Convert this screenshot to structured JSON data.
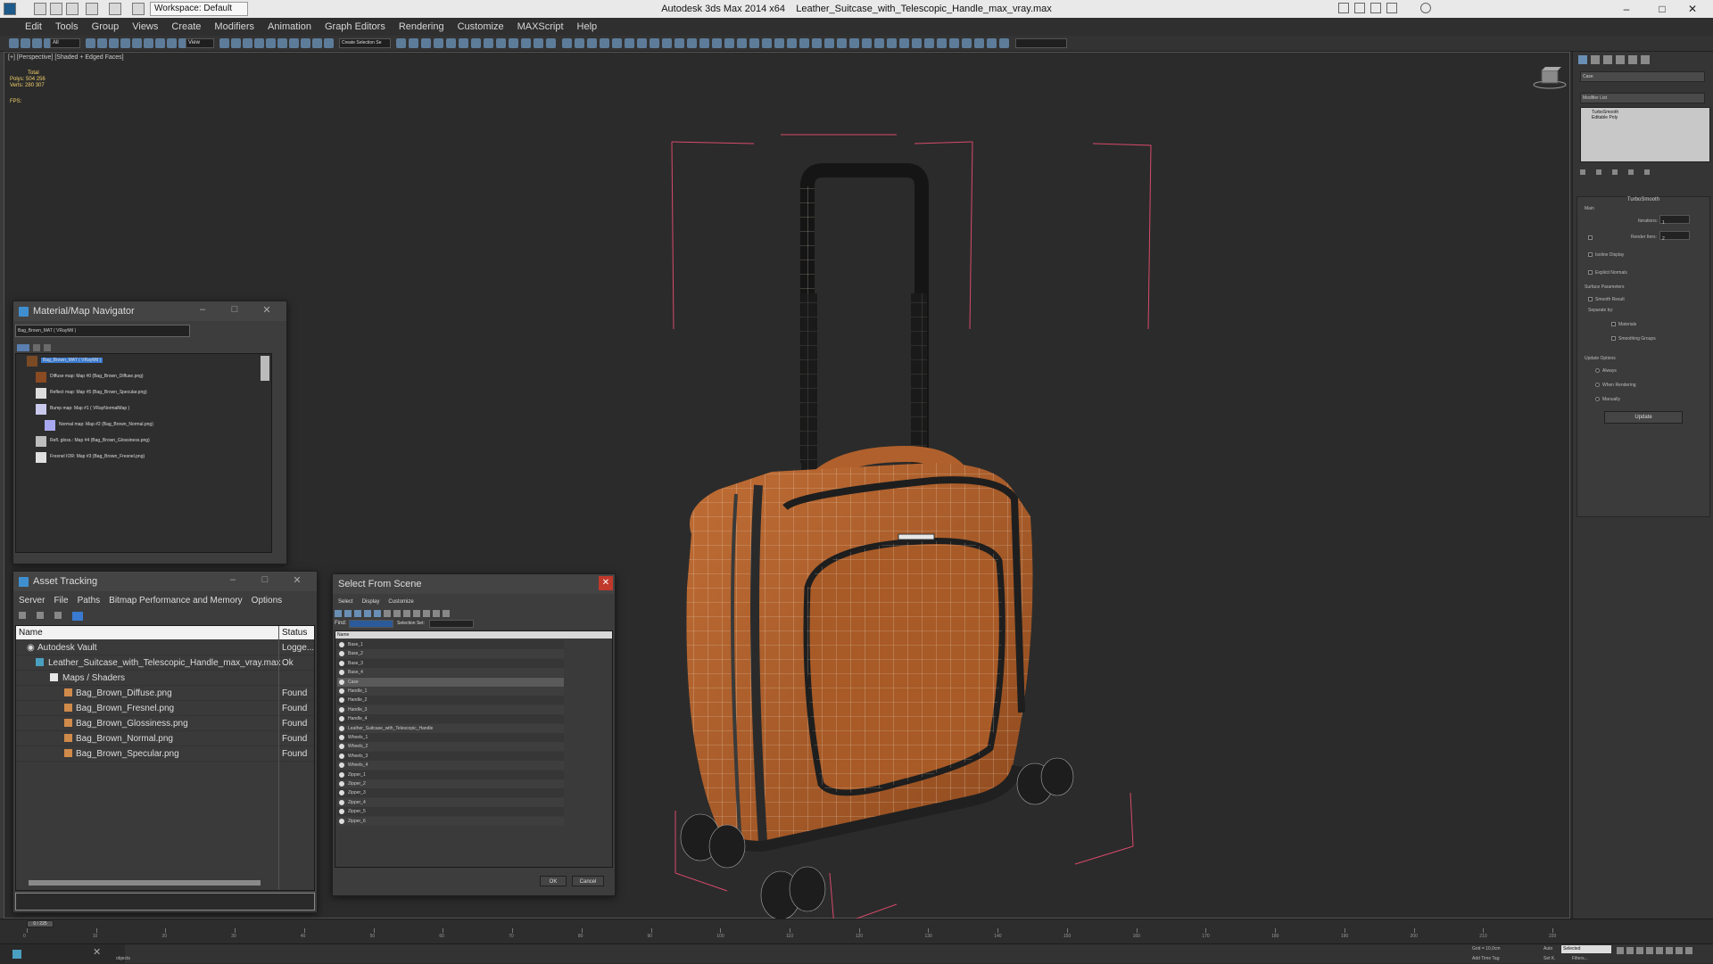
{
  "window": {
    "app_title": "Autodesk 3ds Max  2014 x64",
    "file_title": "Leather_Suitcase_with_Telescopic_Handle_max_vray.max",
    "workspace": "Workspace: Default"
  },
  "menu": [
    "Edit",
    "Tools",
    "Group",
    "Views",
    "Create",
    "Modifiers",
    "Animation",
    "Graph Editors",
    "Rendering",
    "Customize",
    "MAXScript",
    "Help"
  ],
  "toolbar": {
    "selection_filter": "All",
    "ref_coord": "View",
    "named_selection": "Create Selection Se"
  },
  "viewport": {
    "label": "[+] [Perspective] [Shaded + Edged Faces]",
    "stats_title": "Total",
    "polys_label": "Polys:",
    "polys_value": "504 256",
    "verts_label": "Verts:",
    "verts_value": "280 307",
    "fps_label": "FPS:"
  },
  "command_panel": {
    "object_name": "Case",
    "modifier_list": "Modifier List",
    "stack": [
      "TurboSmooth",
      "Editable Poly"
    ],
    "rollout_title": "TurboSmooth",
    "main_label": "Main",
    "iterations_label": "Iterations:",
    "iterations_value": "1",
    "render_iters_label": "Render Iters:",
    "render_iters_value": "2",
    "isoline_label": "Isoline Display",
    "explicit_normals_label": "Explicit Normals",
    "surface_params_label": "Surface Parameters",
    "smooth_result_label": "Smooth Result",
    "separate_by_label": "Separate by:",
    "materials_label": "Materials",
    "smoothing_groups_label": "Smoothing Groups",
    "update_options_label": "Update Options",
    "always_label": "Always",
    "when_rendering_label": "When Rendering",
    "manually_label": "Manually",
    "update_button": "Update"
  },
  "material_navigator": {
    "title": "Material/Map Navigator",
    "current": "Bag_Brown_MAT  ( VRayMtl )",
    "root": "Bag_Brown_MAT  ( VRayMtl )",
    "maps": [
      "Diffuse map: Map #0 (Bag_Brown_Diffuse.png)",
      "Reflect map: Map #5 (Bag_Brown_Specular.png)",
      "Bump map: Map #1  ( VRayNormalMap )",
      "Normal map: Map #2 (Bag_Brown_Normal.png)",
      "Refl. gloss.: Map #4 (Bag_Brown_Glossiness.png)",
      "Fresnel IOR: Map #3 (Bag_Brown_Fresnel.png)"
    ]
  },
  "asset_tracking": {
    "title": "Asset Tracking",
    "menu": [
      "Server",
      "File",
      "Paths",
      "Bitmap Performance and Memory",
      "Options"
    ],
    "columns": [
      "Name",
      "Status"
    ],
    "rows": [
      {
        "name": "Autodesk Vault",
        "status": "Logge..."
      },
      {
        "name": "Leather_Suitcase_with_Telescopic_Handle_max_vray.max",
        "status": "Ok"
      },
      {
        "name": "Maps / Shaders",
        "status": ""
      },
      {
        "name": "Bag_Brown_Diffuse.png",
        "status": "Found"
      },
      {
        "name": "Bag_Brown_Fresnel.png",
        "status": "Found"
      },
      {
        "name": "Bag_Brown_Glossiness.png",
        "status": "Found"
      },
      {
        "name": "Bag_Brown_Normal.png",
        "status": "Found"
      },
      {
        "name": "Bag_Brown_Specular.png",
        "status": "Found"
      }
    ]
  },
  "select_from_scene": {
    "title": "Select From Scene",
    "menu": [
      "Select",
      "Display",
      "Customize"
    ],
    "find_label": "Find:",
    "selection_set_label": "Selection Set:",
    "column_name": "Name",
    "items": [
      "Base_1",
      "Base_2",
      "Base_3",
      "Base_4",
      "Case",
      "Handle_1",
      "Handle_2",
      "Handle_3",
      "Handle_4",
      "Leather_Suitcase_with_Telescopic_Handle",
      "Wheels_1",
      "Wheels_2",
      "Wheels_3",
      "Wheels_4",
      "Zipper_1",
      "Zipper_2",
      "Zipper_3",
      "Zipper_4",
      "Zipper_5",
      "Zipper_6"
    ],
    "selected_item": "Case",
    "ok_label": "OK",
    "cancel_label": "Cancel"
  },
  "timeline": {
    "frame_counter": "0 / 225",
    "ticks": [
      "0",
      "10",
      "20",
      "30",
      "40",
      "50",
      "60",
      "70",
      "80",
      "90",
      "100",
      "110",
      "120",
      "130",
      "140",
      "150",
      "160",
      "170",
      "180",
      "190",
      "200",
      "210",
      "220"
    ]
  },
  "statusbar": {
    "objects_label": "objects",
    "grid_label": "Grid = 10,0cm",
    "auto_label": "Auto",
    "selected_label": "Selected",
    "setk_label": "Set K.",
    "filters_label": "Filters...",
    "add_time_tag": "Add Time Tag"
  },
  "colors": {
    "viewport_bg": "#2b2b2b",
    "suitcase_leather": "#b5652f",
    "wire": "#f0e6d8",
    "bbox": "#d84a6a",
    "selection_highlight": "#3a7ad0",
    "stats_yellow": "#f2d16b"
  }
}
